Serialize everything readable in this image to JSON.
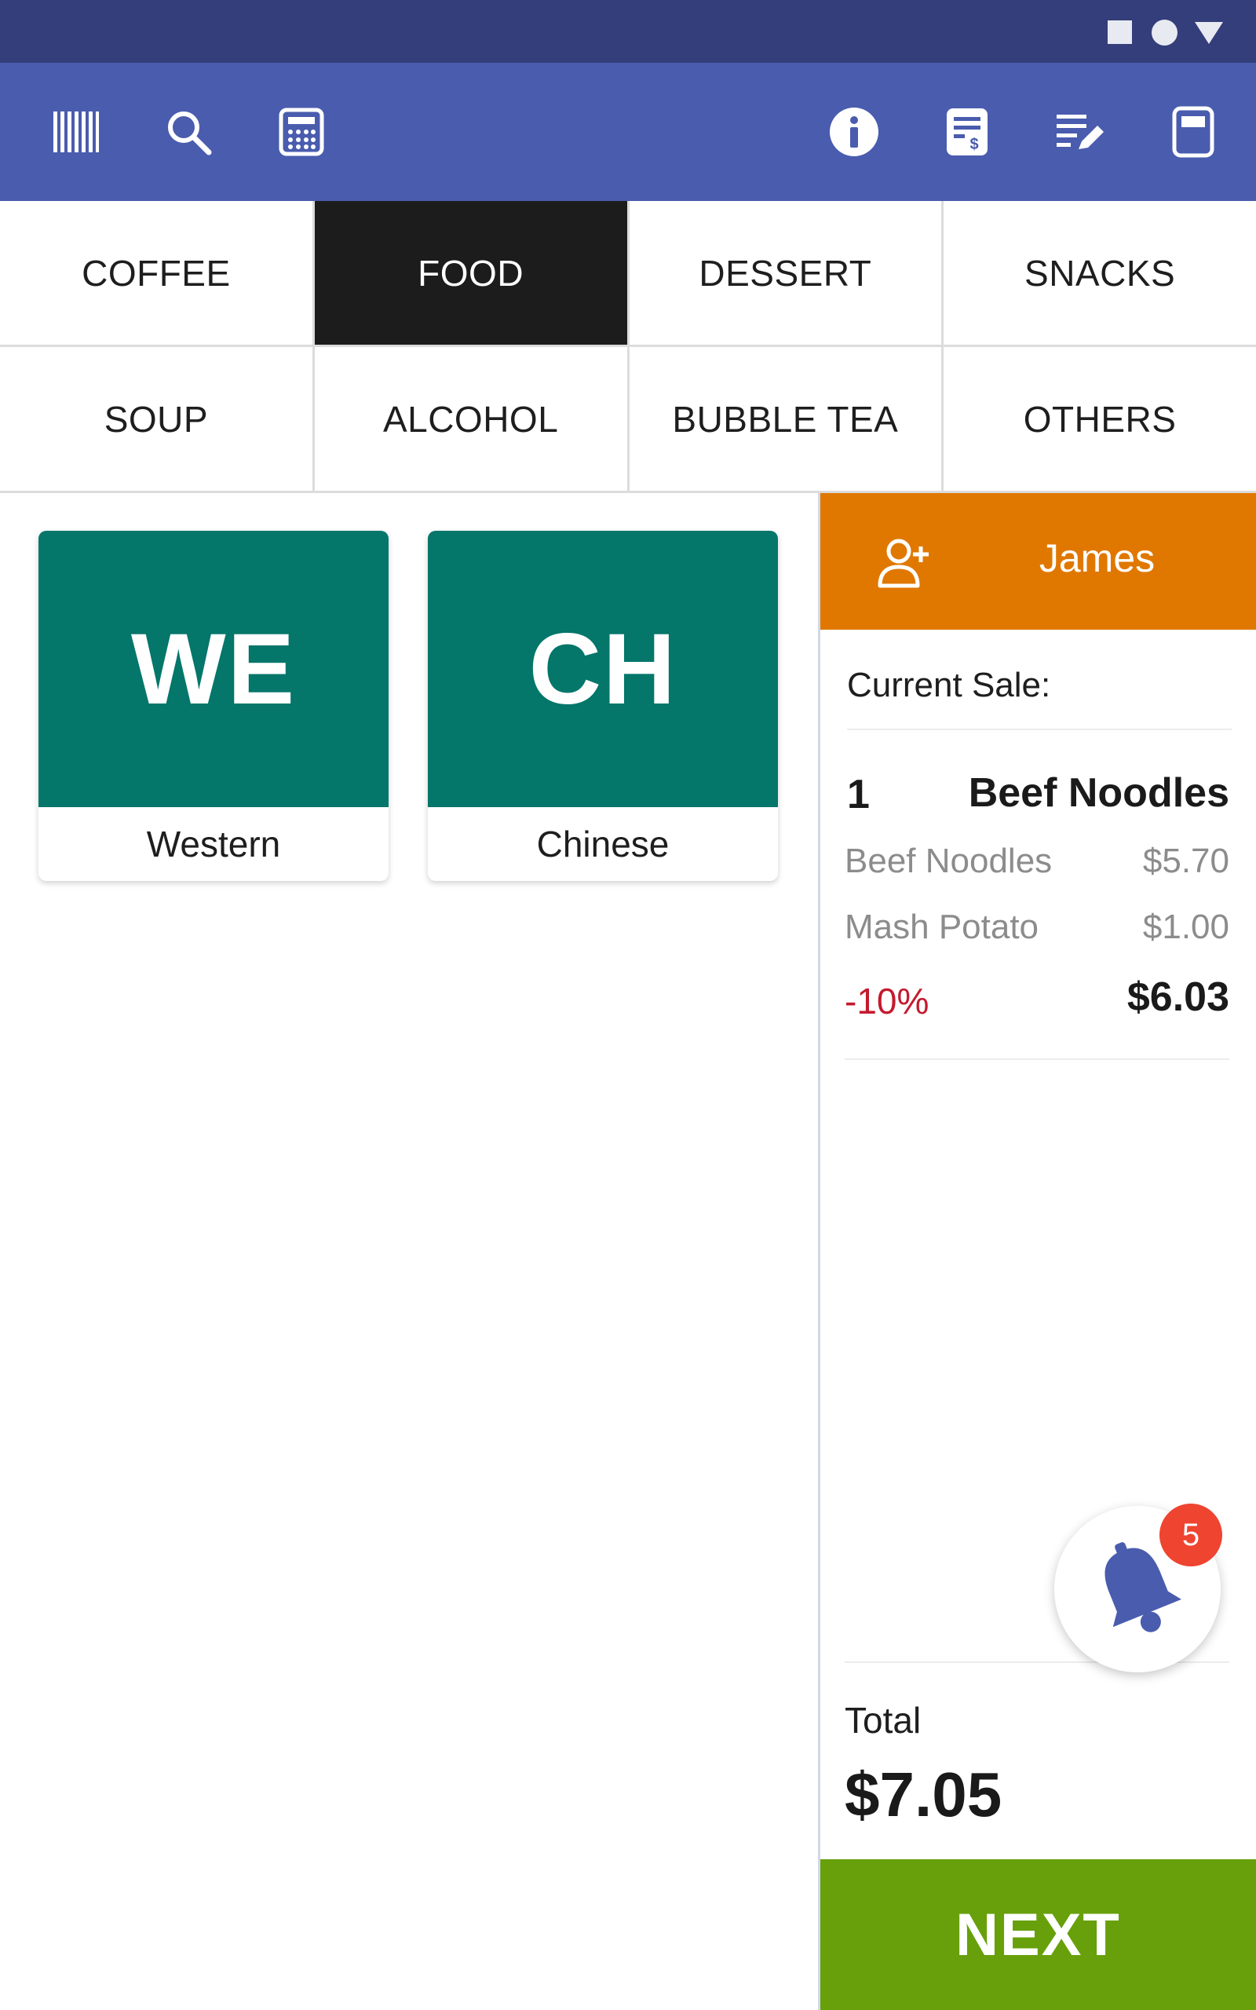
{
  "status_bar": {
    "icons": [
      "square-icon",
      "circle-icon",
      "triangle-icon"
    ]
  },
  "toolbar": {
    "left_icons": [
      "barcode-icon",
      "search-icon",
      "calculator-icon"
    ],
    "right_icons": [
      "info-icon",
      "receipt-icon",
      "edit-list-icon",
      "register-icon"
    ]
  },
  "categories": {
    "active": "FOOD",
    "items": [
      "COFFEE",
      "FOOD",
      "DESSERT",
      "SNACKS",
      "SOUP",
      "ALCOHOL",
      "BUBBLE TEA",
      "OTHERS"
    ]
  },
  "products": [
    {
      "abbr": "WE",
      "name": "Western"
    },
    {
      "abbr": "CH",
      "name": "Chinese"
    }
  ],
  "sale": {
    "customer": "James",
    "header": "Current Sale:",
    "line": {
      "qty": "1",
      "name": "Beef Noodles",
      "modifiers": [
        {
          "name": "Beef Noodles",
          "price": "$5.70"
        },
        {
          "name": "Mash Potato",
          "price": "$1.00"
        }
      ],
      "discount": "-10%",
      "line_total": "$6.03"
    },
    "notifications": "5",
    "total_label": "Total",
    "total": "$7.05",
    "next_label": "NEXT"
  },
  "colors": {
    "status_bar": "#343e7a",
    "toolbar": "#4a5cae",
    "active_category": "#1c1c1c",
    "tile": "#04766a",
    "customer": "#e07800",
    "discount": "#c41a2e",
    "badge": "#ee4430",
    "next": "#67a00a",
    "bell": "#4a5cae"
  }
}
